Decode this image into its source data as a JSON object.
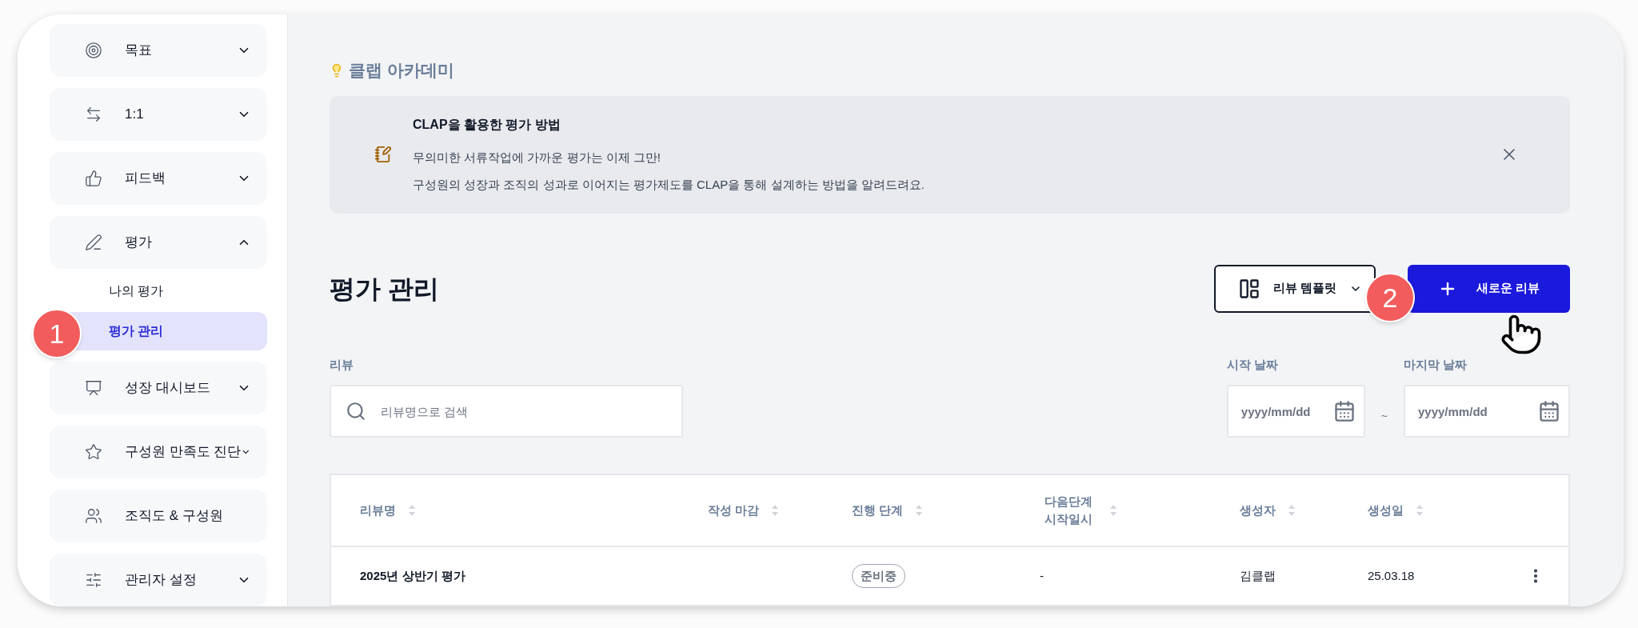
{
  "sidebar": {
    "items": [
      {
        "kind": "menu",
        "label": "목표",
        "expanded": false
      },
      {
        "kind": "menu",
        "label": "1:1",
        "expanded": false
      },
      {
        "kind": "menu",
        "label": "피드백",
        "expanded": false
      },
      {
        "kind": "menu",
        "label": "평가",
        "expanded": true,
        "children": [
          {
            "label": "나의 평가",
            "selected": false
          },
          {
            "label": "평가 관리",
            "selected": true
          }
        ]
      },
      {
        "kind": "menu",
        "label": "성장 대시보드",
        "expanded": false
      },
      {
        "kind": "menu",
        "label": "구성원 만족도 진단",
        "expanded": false
      },
      {
        "kind": "link",
        "label": "조직도 & 구성원"
      },
      {
        "kind": "menu",
        "label": "관리자 설정",
        "expanded": false
      }
    ]
  },
  "academy": {
    "title": "클랩 아카데미",
    "banner": {
      "title": "CLAP을 활용한 평가 방법",
      "lines": [
        "무의미한 서류작업에 가까운 평가는 이제 그만!",
        "구성원의 성장과 조직의 성과로 이어지는 평가제도를 CLAP을 통해 설계하는 방법을 알려드려요."
      ]
    }
  },
  "page": {
    "title": "평가 관리",
    "buttons": [
      {
        "kind": "template",
        "label": "리뷰 템플릿"
      },
      {
        "kind": "new",
        "label": "새로운 리뷰"
      }
    ]
  },
  "filters": {
    "review_label": "리뷰",
    "search_placeholder": "리뷰명으로 검색",
    "start_label": "시작 날짜",
    "start_placeholder": "yyyy/mm/dd",
    "separator": "~",
    "end_label": "마지막 날짜",
    "end_placeholder": "yyyy/mm/dd"
  },
  "table": {
    "columns": [
      "리뷰명",
      "작성 마감",
      "진행 단계",
      "다음단계 시작일시",
      "생성자",
      "생성일"
    ],
    "rows": [
      {
        "name": "2025년 상반기 평가",
        "stage": "준비중",
        "next_start": "-",
        "creator": "김클랩",
        "created": "25.03.18"
      }
    ]
  },
  "annotations": [
    {
      "text": "1"
    },
    {
      "text": "2"
    }
  ]
}
